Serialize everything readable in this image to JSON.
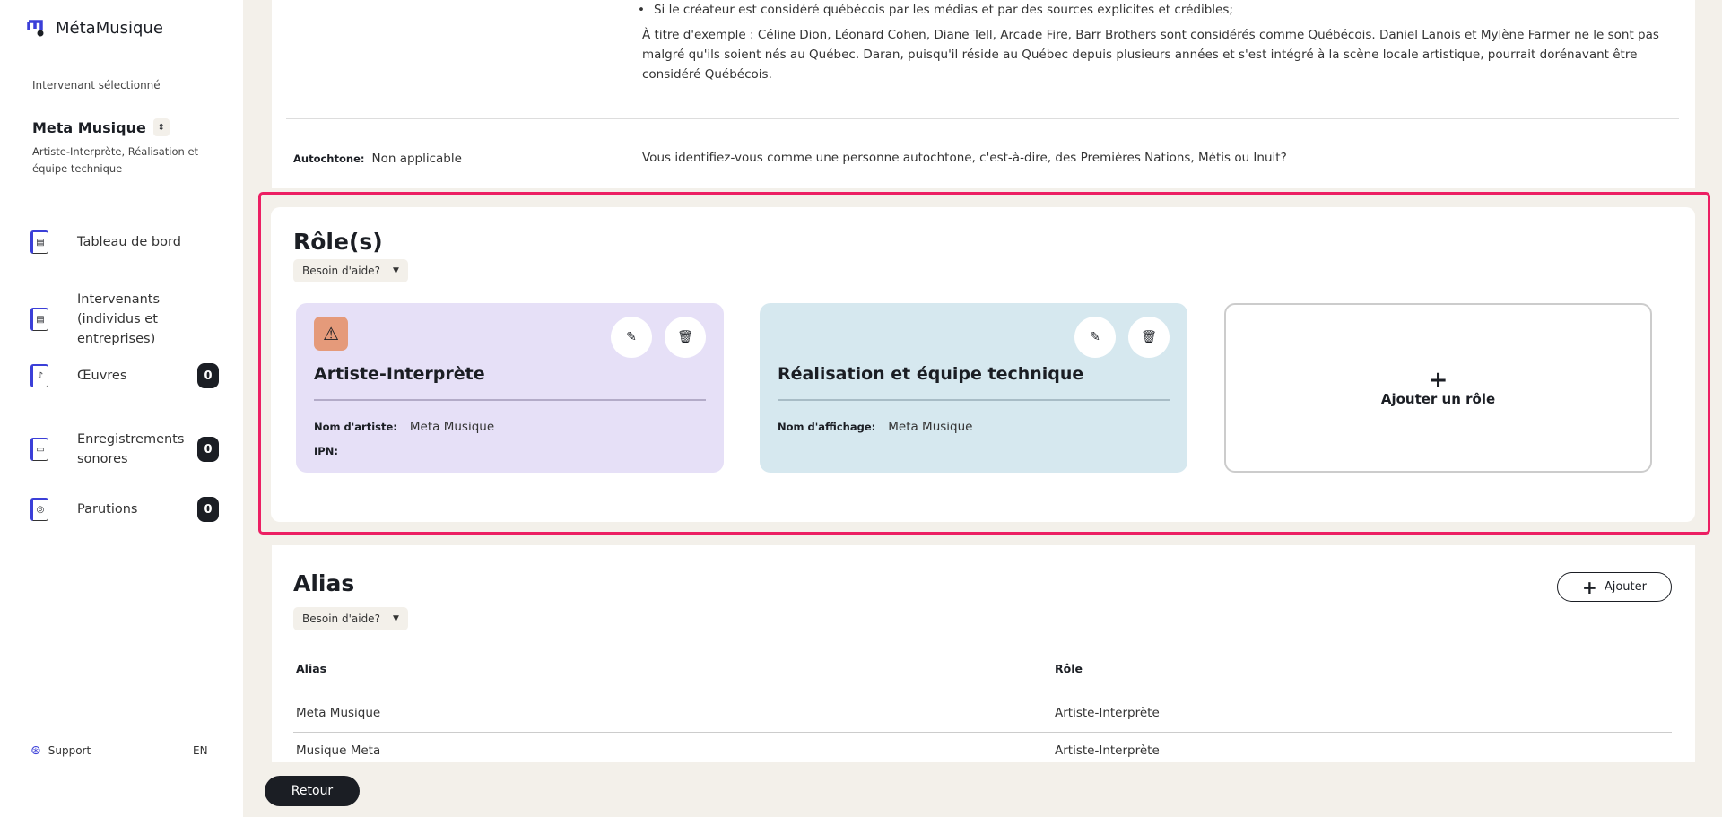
{
  "app": {
    "name": "MétaMusique"
  },
  "sidebar": {
    "selected_label": "Intervenant sélectionné",
    "selected_name": "Meta Musique",
    "selected_roles": "Artiste-Interprète, Réalisation et équipe technique",
    "items": [
      {
        "label": "Tableau de bord",
        "icon": "dashboard-icon"
      },
      {
        "label": "Intervenants (individus et entreprises)",
        "icon": "dashboard-icon"
      },
      {
        "label": "Œuvres",
        "icon": "music-sheet-icon",
        "count": "0"
      },
      {
        "label": "Enregistrements sonores",
        "icon": "cassette-icon",
        "count": "0"
      },
      {
        "label": "Parutions",
        "icon": "disc-icon",
        "count": "0"
      }
    ],
    "support": "Support",
    "lang": "EN"
  },
  "top": {
    "bullet": "Si le créateur est considéré québécois par les médias et par des sources explicites et crédibles;",
    "example": "À titre d'exemple : Céline Dion, Léonard Cohen, Diane Tell, Arcade Fire, Barr Brothers sont considérés comme Québécois. Daniel Lanois et Mylène Farmer ne le sont pas malgré qu'ils soient nés au Québec. Daran, puisqu'il réside au Québec depuis plusieurs années et s'est intégré à la scène locale artistique, pourrait dorénavant être considéré Québécois.",
    "autochtone_label": "Autochtone:",
    "autochtone_value": "Non applicable",
    "autochtone_question": "Vous identifiez-vous comme une personne autochtone, c'est-à-dire, des Premières Nations, Métis ou Inuit?"
  },
  "roles": {
    "title": "Rôle(s)",
    "help": "Besoin d'aide?",
    "cards": [
      {
        "title": "Artiste-Interprète",
        "f1_label": "Nom d'artiste:",
        "f1_value": "Meta Musique",
        "f2_label": "IPN:",
        "color": "#e6e0f7",
        "warning": true
      },
      {
        "title": "Réalisation et équipe technique",
        "f1_label": "Nom d'affichage:",
        "f1_value": "Meta Musique",
        "color": "#d6e8ef"
      }
    ],
    "add": "Ajouter un rôle"
  },
  "alias": {
    "title": "Alias",
    "help": "Besoin d'aide?",
    "add": "Ajouter",
    "headers": [
      "Alias",
      "Rôle"
    ],
    "rows": [
      [
        "Meta Musique",
        "Artiste-Interprète"
      ],
      [
        "Musique Meta",
        "Artiste-Interprète"
      ]
    ]
  },
  "footer": {
    "back": "Retour"
  }
}
